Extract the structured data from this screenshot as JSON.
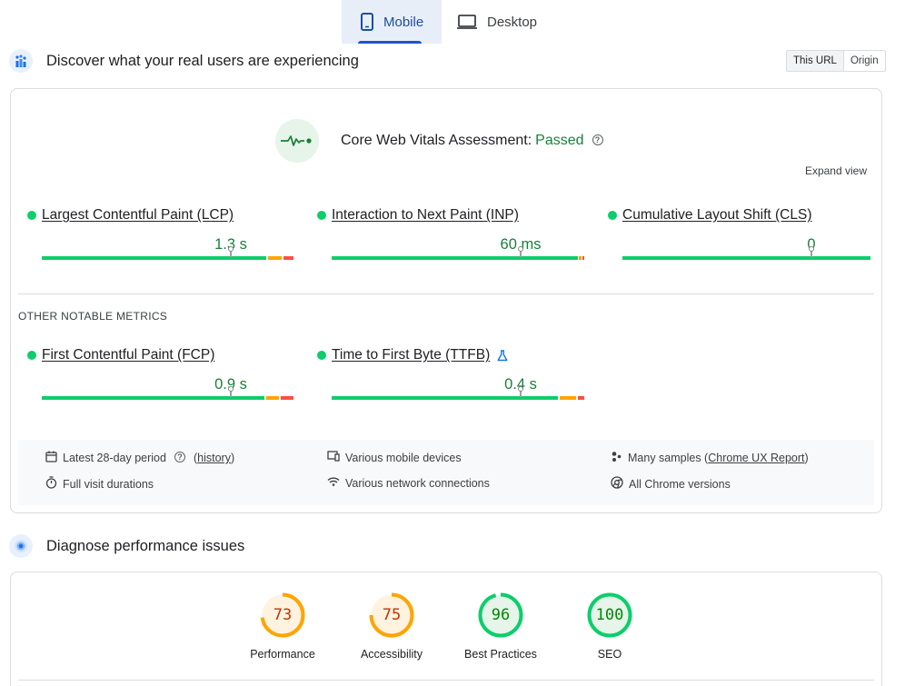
{
  "tabs": {
    "mobile": "Mobile",
    "desktop": "Desktop",
    "selected": "mobile"
  },
  "field": {
    "title": "Discover what your real users are experiencing",
    "toggle": {
      "this_url": "This URL",
      "origin": "Origin",
      "selected": "this_url"
    },
    "assessment": {
      "label": "Core Web Vitals Assessment:",
      "status": "Passed",
      "help": "?"
    },
    "expand": "Expand view",
    "metrics": [
      {
        "label": "Largest Contentful Paint (LCP)",
        "value": "1.3 s"
      },
      {
        "label": "Interaction to Next Paint (INP)",
        "value": "60 ms"
      },
      {
        "label": "Cumulative Layout Shift (CLS)",
        "value": "0"
      }
    ],
    "other_title": "OTHER NOTABLE METRICS",
    "other_metrics": [
      {
        "label": "First Contentful Paint (FCP)",
        "value": "0.9 s"
      },
      {
        "label": "Time to First Byte (TTFB)",
        "value": "0.4 s",
        "experimental_icon": "beaker-icon"
      }
    ],
    "info": {
      "period": "Latest 28-day period",
      "history_open": "(",
      "history": "history",
      "history_close": ")",
      "devices": "Various mobile devices",
      "samples": "Many samples (",
      "samples_link": "Chrome UX Report",
      "samples_close": ")",
      "durations": "Full visit durations",
      "network": "Various network connections",
      "versions": "All Chrome versions"
    }
  },
  "diagnose": {
    "title": "Diagnose performance issues",
    "scores": [
      {
        "label": "Performance",
        "score": "73",
        "fraction": 0.73,
        "status": "average"
      },
      {
        "label": "Accessibility",
        "score": "75",
        "fraction": 0.75,
        "status": "average"
      },
      {
        "label": "Best Practices",
        "score": "96",
        "fraction": 0.96,
        "status": "pass"
      },
      {
        "label": "SEO",
        "score": "100",
        "fraction": 1.0,
        "status": "pass"
      }
    ]
  },
  "colors": {
    "good": "#0cce6b",
    "needs_improvement": "#ffa400",
    "poor": "#ff4e42",
    "passed_text": "#188038",
    "average_text": "#c33300",
    "pass_text": "#008800",
    "average_fill": "#fff3e0",
    "pass_fill": "#e6f4ea"
  }
}
